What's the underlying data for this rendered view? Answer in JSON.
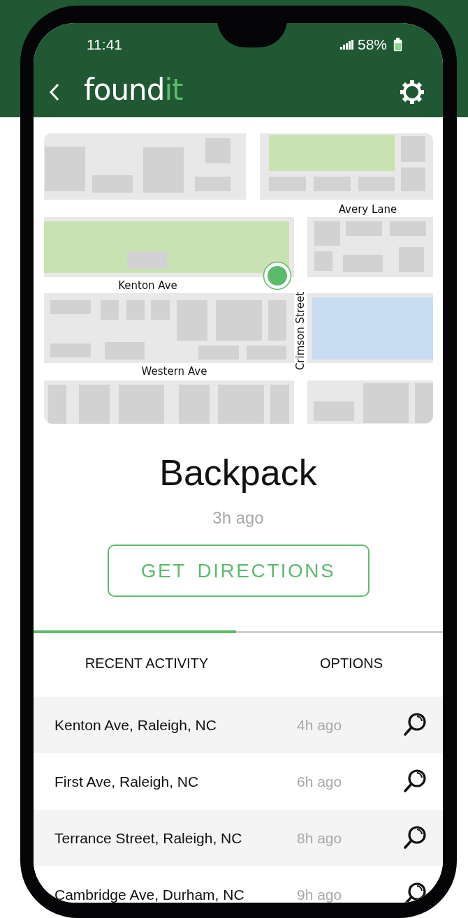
{
  "status_bar": {
    "time": "11:41",
    "battery": "58%"
  },
  "app_bar": {
    "logo_main": "found",
    "logo_accent": "it"
  },
  "map": {
    "streets": [
      {
        "name": "Avery Lane",
        "kind": "horizontal"
      },
      {
        "name": "Kenton Ave",
        "kind": "horizontal"
      },
      {
        "name": "Western Ave",
        "kind": "horizontal"
      },
      {
        "name": "Crimson Street",
        "kind": "vertical"
      }
    ]
  },
  "item": {
    "name": "Backpack",
    "last_seen": "3h ago"
  },
  "action_button": "GET DIRECTIONS",
  "tabs": [
    {
      "label": "RECENT ACTIVITY",
      "selected": true
    },
    {
      "label": "OPTIONS",
      "selected": false
    }
  ],
  "activity": [
    {
      "place": "Kenton Ave, Raleigh, NC",
      "time": "4h ago"
    },
    {
      "place": "First Ave, Raleigh, NC",
      "time": "6h ago"
    },
    {
      "place": "Terrance Street, Raleigh, NC",
      "time": "8h ago"
    },
    {
      "place": "Cambridge Ave, Durham, NC",
      "time": "9h ago"
    }
  ]
}
